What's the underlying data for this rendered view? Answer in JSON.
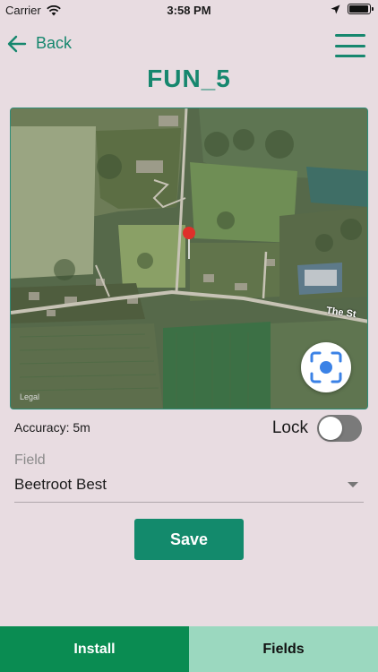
{
  "status_bar": {
    "carrier": "Carrier",
    "time": "3:58 PM",
    "battery_level": 0.95
  },
  "nav": {
    "back_label": "Back",
    "menu_icon": "hamburger-menu-icon"
  },
  "title": "FUN_5",
  "map": {
    "road_label": "The St",
    "legal_label": "Legal",
    "pin_color": "#e0302a",
    "locate_icon": "location-target-icon"
  },
  "accuracy": "Accuracy: 5m",
  "lock": {
    "label": "Lock",
    "enabled": false
  },
  "field": {
    "label": "Field",
    "value": "Beetroot Best"
  },
  "save_label": "Save",
  "tabs": [
    {
      "label": "Install",
      "color": "#0a8c52"
    },
    {
      "label": "Fields",
      "color": "#9bd8bf"
    }
  ],
  "colors": {
    "accent": "#16876e",
    "background": "#e8dce1"
  }
}
